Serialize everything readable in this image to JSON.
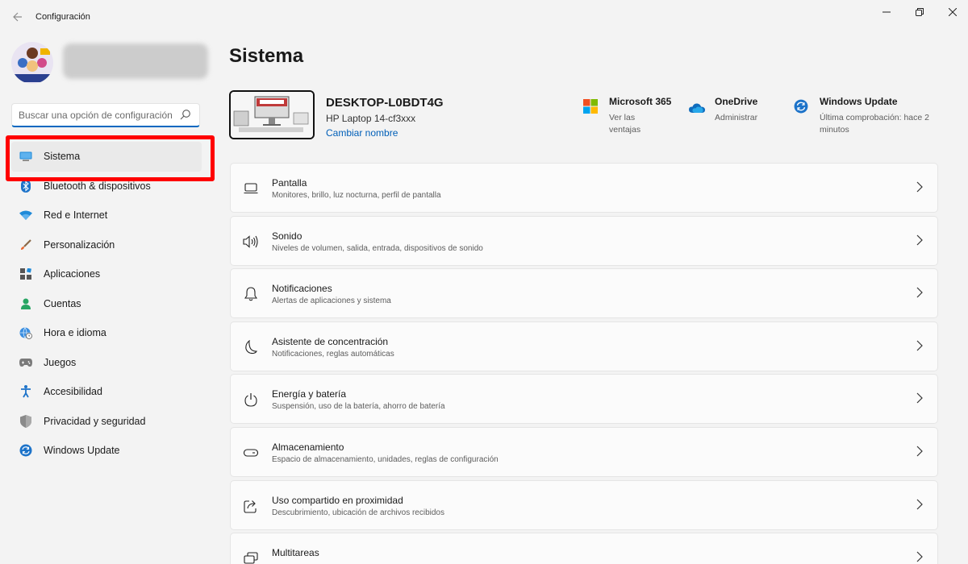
{
  "window": {
    "title": "Configuración"
  },
  "search": {
    "placeholder": "Buscar una opción de configuración"
  },
  "sidebar": {
    "items": [
      {
        "label": "Sistema",
        "icon": "monitor-icon"
      },
      {
        "label": "Bluetooth & dispositivos",
        "icon": "bluetooth-icon"
      },
      {
        "label": "Red e Internet",
        "icon": "wifi-icon"
      },
      {
        "label": "Personalización",
        "icon": "brush-icon"
      },
      {
        "label": "Aplicaciones",
        "icon": "apps-icon"
      },
      {
        "label": "Cuentas",
        "icon": "account-icon"
      },
      {
        "label": "Hora e idioma",
        "icon": "globe-clock-icon"
      },
      {
        "label": "Juegos",
        "icon": "gamepad-icon"
      },
      {
        "label": "Accesibilidad",
        "icon": "accessibility-icon"
      },
      {
        "label": "Privacidad y seguridad",
        "icon": "shield-icon"
      },
      {
        "label": "Windows Update",
        "icon": "update-icon"
      }
    ]
  },
  "main": {
    "title": "Sistema",
    "device": {
      "name": "DESKTOP-L0BDT4G",
      "model": "HP Laptop 14-cf3xxx",
      "rename": "Cambiar nombre"
    },
    "quick": [
      {
        "title": "Microsoft 365",
        "sub": "Ver las ventajas",
        "icon": "microsoft-365-icon"
      },
      {
        "title": "OneDrive",
        "sub": "Administrar",
        "icon": "onedrive-icon"
      },
      {
        "title": "Windows Update",
        "sub": "Última comprobación: hace 2",
        "sub2": "minutos",
        "icon": "windows-update-icon"
      }
    ],
    "cards": [
      {
        "title": "Pantalla",
        "sub": "Monitores, brillo, luz nocturna, perfil de pantalla",
        "icon": "display-icon"
      },
      {
        "title": "Sonido",
        "sub": "Niveles de volumen, salida, entrada, dispositivos de sonido",
        "icon": "speaker-icon"
      },
      {
        "title": "Notificaciones",
        "sub": "Alertas de aplicaciones y sistema",
        "icon": "bell-icon"
      },
      {
        "title": "Asistente de concentración",
        "sub": "Notificaciones, reglas automáticas",
        "icon": "moon-icon"
      },
      {
        "title": "Energía y batería",
        "sub": "Suspensión, uso de la batería, ahorro de batería",
        "icon": "power-icon"
      },
      {
        "title": "Almacenamiento",
        "sub": "Espacio de almacenamiento, unidades, reglas de configuración",
        "icon": "storage-icon"
      },
      {
        "title": "Uso compartido en proximidad",
        "sub": "Descubrimiento, ubicación de archivos recibidos",
        "icon": "share-icon"
      },
      {
        "title": "Multitareas",
        "sub": "",
        "icon": "multitask-icon"
      }
    ]
  },
  "colors": {
    "accent": "#0067c0",
    "highlight": "#ff0000",
    "background": "#f3f3f3"
  }
}
